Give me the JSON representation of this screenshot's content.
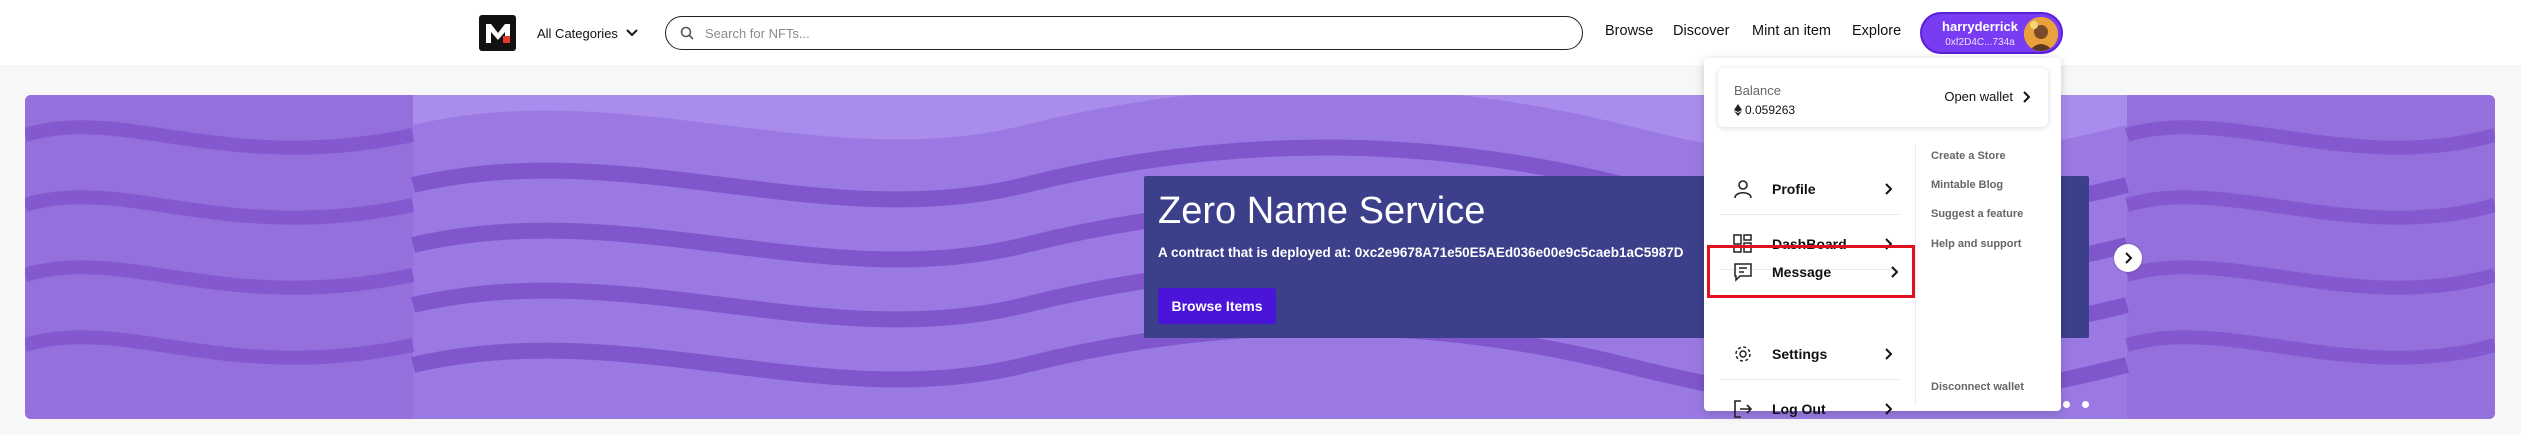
{
  "header": {
    "categories_label": "All Categories",
    "search_placeholder": "Search for NFTs...",
    "nav": {
      "browse": "Browse",
      "discover": "Discover",
      "mint": "Mint an item",
      "explore": "Explore"
    },
    "user": {
      "name": "harryderrick",
      "address": "0xf2D4C...734a"
    }
  },
  "banner": {
    "title": "Zero Name Service",
    "subtitle": "A contract that is deployed at: 0xc2e9678A71e50E5AEd036e00e9c5caeb1aC5987D",
    "button_label": "Browse Items"
  },
  "menu": {
    "balance_label": "Balance",
    "balance_value": "0.059263",
    "open_wallet": "Open wallet",
    "items": [
      {
        "label": "Profile",
        "icon": "user-icon"
      },
      {
        "label": "DashBoard",
        "icon": "dashboard-icon"
      },
      {
        "label": "Message",
        "icon": "message-icon"
      },
      {
        "label": "Settings",
        "icon": "gear-icon"
      },
      {
        "label": "Log Out",
        "icon": "logout-icon"
      }
    ],
    "side_links": [
      "Create a Store",
      "Mintable Blog",
      "Suggest a feature",
      "Help and support"
    ],
    "disconnect": "Disconnect wallet"
  },
  "colors": {
    "accent": "#7a3cf2",
    "button": "#4a14d9",
    "highlight": "#e0101f",
    "hero_bg": "#3c3f8a"
  }
}
